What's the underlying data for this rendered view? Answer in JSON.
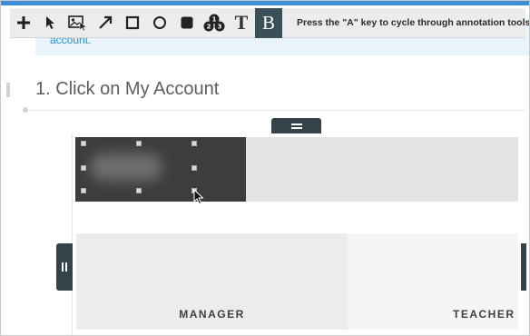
{
  "toolbar": {
    "tools": [
      {
        "icon": "plus-icon"
      },
      {
        "icon": "pointer-arrow-icon"
      },
      {
        "icon": "image-select-icon"
      },
      {
        "icon": "diagonal-arrow-icon"
      },
      {
        "icon": "rectangle-icon"
      },
      {
        "icon": "circle-icon"
      },
      {
        "icon": "filled-square-icon"
      },
      {
        "icon": "numbered-steps-icon"
      },
      {
        "icon": "text-tool-icon",
        "label": "T"
      },
      {
        "icon": "blur-tool-icon",
        "label": "B",
        "active": true
      }
    ],
    "hint": "Press the \"A\" key to cycle through annotation tools. Us"
  },
  "page": {
    "alert_link": "account.",
    "step_heading": "1. Click on My Account"
  },
  "cards": {
    "manager": "MANAGER",
    "teacher": "TEACHER"
  },
  "colors": {
    "accent": "#3c8fd8",
    "toolbar_active": "#3a4f57",
    "handle_dark": "#34424a",
    "link": "#2f8ec8"
  }
}
